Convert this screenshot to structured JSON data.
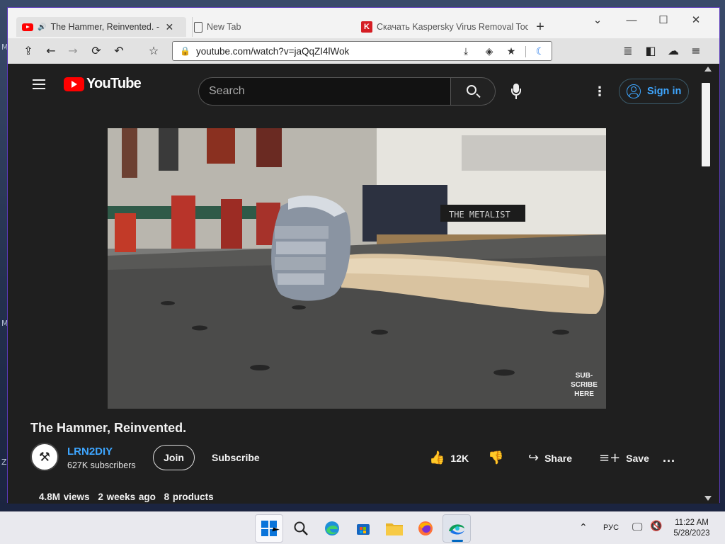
{
  "browser": {
    "tabs": [
      {
        "title": "The Hammer, Reinvented. - YouTube",
        "active": true
      },
      {
        "title": "New Tab",
        "active": false
      },
      {
        "title": "Скачать Kaspersky Virus Removal Tool",
        "active": false
      }
    ],
    "window_controls": {
      "dropdown": "⌄",
      "minimize": "—",
      "maximize": "☐",
      "close": "✕"
    },
    "url": "youtube.com/watch?v=jaQqZI4lWok"
  },
  "youtube": {
    "logo_text": "YouTube",
    "search_placeholder": "Search",
    "sign_in": "Sign in",
    "video": {
      "overlay_text": [
        "SUB-",
        "SCRIBE",
        "HERE"
      ],
      "wall_sign": "THE METALIST"
    },
    "title": "The Hammer, Reinvented.",
    "channel": {
      "name": "LRN2DIY",
      "subscribers": "627K subscribers"
    },
    "join_label": "Join",
    "subscribe_label": "Subscribe",
    "like_count": "12K",
    "share_label": "Share",
    "save_label": "Save",
    "more_label": "...",
    "meta": {
      "views": "4.8M views",
      "age": "2 weeks ago",
      "products": "8 products"
    }
  },
  "taskbar": {
    "language": "РУС",
    "time": "11:22 AM",
    "date": "5/28/2023"
  },
  "colors": {
    "yt_red": "#ff0000",
    "yt_link_blue": "#3ea6ff",
    "page_bg": "#1f1f1f",
    "window_frame": "#4a2aa0"
  }
}
